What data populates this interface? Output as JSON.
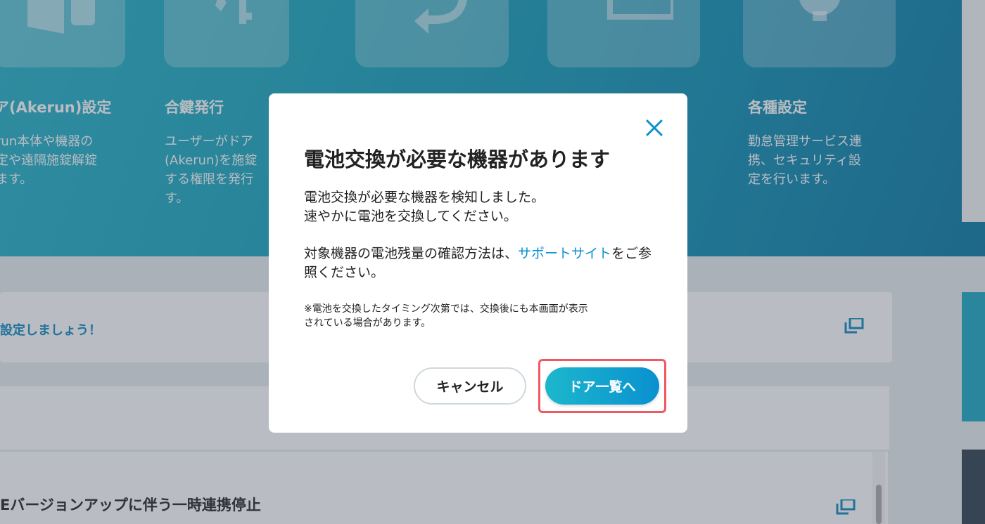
{
  "hero": {
    "tiles": [
      {
        "title": "ア(Akerun)設定",
        "desc": "run本体や機器の\n定や遠隔施錠解錠\nます。"
      },
      {
        "title": "合鍵発行",
        "desc": "ユーザーがドア\n(Akerun)を施錠\nする権限を発行\nす。"
      },
      {
        "title": "各種設定",
        "desc": "勤怠管理サービス連\n携、セキュリティ設\n定を行います。"
      }
    ]
  },
  "cards": {
    "setup_text": "設定しましょう！",
    "news_text": "Eバージョンアップに伴う一時連携停止"
  },
  "modal": {
    "title": "電池交換が必要な機器があります",
    "body_line1": "電池交換が必要な機器を検知しました。\n速やかに電池を交換してください。",
    "body_line2_prefix": "対象機器の電池残量の確認方法は、",
    "link_text": "サポートサイト",
    "body_line2_suffix": "をご参照ください。",
    "note": "※電池を交換したタイミング次第では、交換後にも本画面が表示\nされている場合があります。",
    "cancel_label": "キャンセル",
    "primary_label": "ドア一覧へ"
  },
  "colors": {
    "accent": "#0a8fd1",
    "highlight": "#ef5a62"
  }
}
